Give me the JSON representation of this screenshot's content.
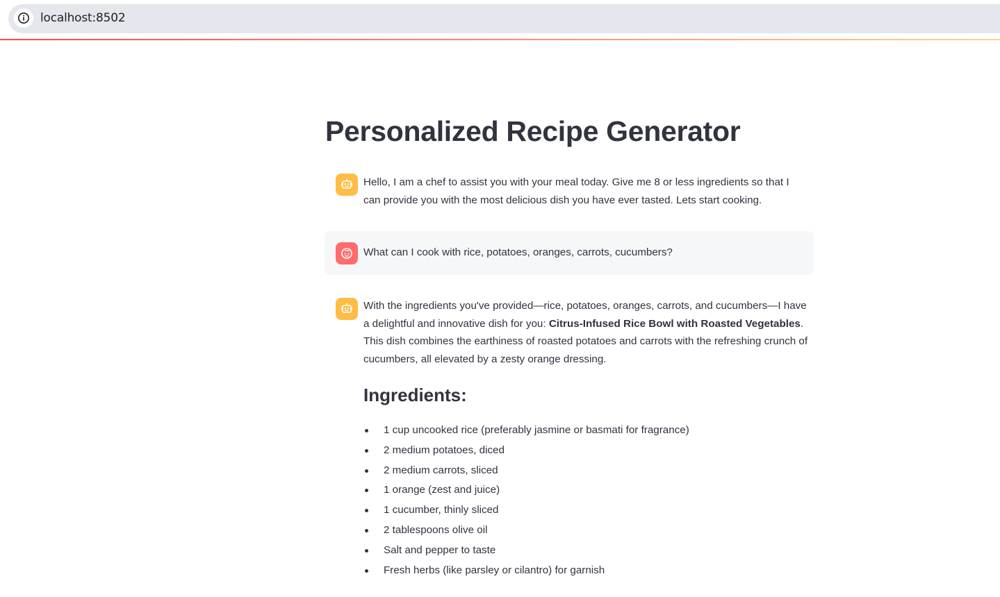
{
  "browser": {
    "url": "localhost:8502",
    "icon": "info-icon"
  },
  "page": {
    "title": "Personalized Recipe Generator"
  },
  "messages": [
    {
      "role": "assistant",
      "avatar_icon": "bot-icon",
      "text": "Hello, I am a chef to assist you with your meal today. Give me 8 or less ingredients so that I can provide you with the most delicious dish you have ever tasted. Lets start cooking."
    },
    {
      "role": "user",
      "avatar_icon": "face-icon",
      "text": "What can I cook with rice, potatoes, oranges, carrots, cucumbers?"
    },
    {
      "role": "assistant",
      "avatar_icon": "bot-icon",
      "intro_before": "With the ingredients you've provided—rice, potatoes, oranges, carrots, and cucumbers—I have a delightful and innovative dish for you: ",
      "dish_name": "Citrus-Infused Rice Bowl with Roasted Vegetables",
      "intro_after": ". This dish combines the earthiness of roasted potatoes and carrots with the refreshing crunch of cucumbers, all elevated by a zesty orange dressing.",
      "ingredients_heading": "Ingredients:",
      "ingredients": [
        "1 cup uncooked rice (preferably jasmine or basmati for fragrance)",
        "2 medium potatoes, diced",
        "2 medium carrots, sliced",
        "1 orange (zest and juice)",
        "1 cucumber, thinly sliced",
        "2 tablespoons olive oil",
        "Salt and pepper to taste",
        "Fresh herbs (like parsley or cilantro) for garnish"
      ]
    }
  ],
  "colors": {
    "assistant_avatar": "#ffbd45",
    "user_avatar": "#ff6c6c",
    "text": "#31333f",
    "user_msg_bg": "#f6f7f9"
  }
}
